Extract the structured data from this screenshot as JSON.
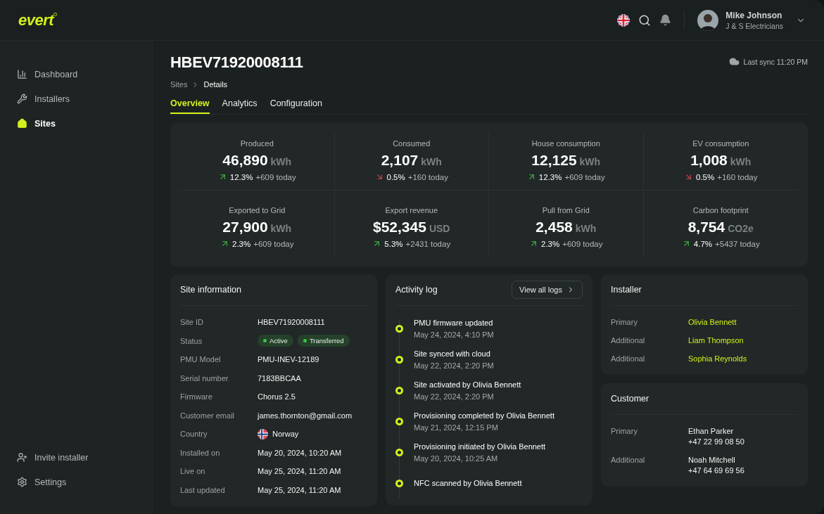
{
  "brand": {
    "logo": "evert"
  },
  "header": {
    "user": {
      "name": "Mike Johnson",
      "company": "J & S Electricians"
    }
  },
  "sidebar": {
    "items": [
      {
        "label": "Dashboard",
        "selected": false
      },
      {
        "label": "Installers",
        "selected": false
      },
      {
        "label": "Sites",
        "selected": true
      }
    ],
    "footer_items": [
      {
        "label": "Invite installer"
      },
      {
        "label": "Settings"
      }
    ]
  },
  "page": {
    "title": "HBEV71920008111",
    "last_sync": "Last sync 11:20 PM",
    "breadcrumb": [
      "Sites",
      "Details"
    ],
    "tabs": [
      {
        "label": "Overview",
        "selected": true
      },
      {
        "label": "Analytics",
        "selected": false
      },
      {
        "label": "Configuration",
        "selected": false
      }
    ]
  },
  "stats": [
    {
      "label": "Produced",
      "value": "46,890",
      "unit": "kWh",
      "kind": "up",
      "change": "12.3%",
      "today": "+609 today"
    },
    {
      "label": "Consumed",
      "value": "2,107",
      "unit": "kWh",
      "kind": "down",
      "change": "0.5%",
      "today": "+160 today"
    },
    {
      "label": "House consumption",
      "value": "12,125",
      "unit": "kWh",
      "kind": "up",
      "change": "12.3%",
      "today": "+609 today"
    },
    {
      "label": "EV consumption",
      "value": "1,008",
      "unit": "kWh",
      "kind": "down",
      "change": "0.5%",
      "today": "+160 today"
    },
    {
      "label": "Exported to Grid",
      "value": "27,900",
      "unit": "kWh",
      "kind": "up",
      "change": "2.3%",
      "today": "+609 today"
    },
    {
      "label": "Export revenue",
      "value": "$52,345",
      "unit": "USD",
      "kind": "up",
      "change": "5.3%",
      "today": "+2431 today"
    },
    {
      "label": "Pull from Grid",
      "value": "2,458",
      "unit": "kWh",
      "kind": "up",
      "change": "2.3%",
      "today": "+609 today"
    },
    {
      "label": "Carbon footprint",
      "value": "8,754",
      "unit": "CO2e",
      "kind": "up",
      "change": "4.7%",
      "today": "+5437 today"
    }
  ],
  "site_information": {
    "title": "Site information",
    "rows": [
      {
        "label": "Site ID",
        "kind": "text",
        "value": "HBEV71920008111"
      },
      {
        "label": "Status",
        "kind": "badges",
        "badges": [
          {
            "label": "Active",
            "color": "#3fbf4a"
          },
          {
            "label": "Transferred",
            "color": "#3fbf4a"
          }
        ]
      },
      {
        "label": "PMU Model",
        "kind": "text",
        "value": "PMU-INEV-12189"
      },
      {
        "label": "Serial number",
        "kind": "text",
        "value": "7183BBCAA"
      },
      {
        "label": "Firmware",
        "kind": "text",
        "value": "Chorus 2.5"
      },
      {
        "label": "Customer email",
        "kind": "text",
        "value": "james.thornton@gmail.com"
      },
      {
        "label": "Country",
        "kind": "country",
        "value": "Norway"
      },
      {
        "label": "Installed on",
        "kind": "text",
        "value": "May 20, 2024, 10:20 AM"
      },
      {
        "label": "Live on",
        "kind": "text",
        "value": "May 25, 2024, 11:20 AM"
      },
      {
        "label": "Last updated",
        "kind": "text",
        "value": "May 25, 2024, 11:20 AM"
      }
    ]
  },
  "activity_log": {
    "title": "Activity log",
    "button": "View all logs",
    "items": [
      {
        "event": "PMU firmware updated",
        "time": "May 24, 2024, 4:10 PM"
      },
      {
        "event": "Site synced with cloud",
        "time": "May 22, 2024, 2:20 PM"
      },
      {
        "event": "Site activated by Olivia Bennett",
        "time": "May 22, 2024, 2:20 PM"
      },
      {
        "event": "Provisioning completed by Olivia Bennett",
        "time": "May 21, 2024, 12:15 PM"
      },
      {
        "event": "Provisioning initiated by Olivia Bennett",
        "time": "May 20, 2024, 10:25 AM"
      },
      {
        "event": "NFC scanned by Olivia Bennett"
      }
    ]
  },
  "installer": {
    "title": "Installer",
    "rows": [
      {
        "role": "Primary",
        "name": "Olivia Bennett"
      },
      {
        "role": "Additional",
        "name": "Liam Thompson"
      },
      {
        "role": "Additional",
        "name": "Sophia Reynolds"
      }
    ]
  },
  "customer": {
    "title": "Customer",
    "rows": [
      {
        "role": "Primary",
        "name": "Ethan Parker",
        "phone": "+47 22 99 08 50"
      },
      {
        "role": "Additional",
        "name": "Noah Mitchell",
        "phone": "+47 64 69 69 56"
      }
    ]
  }
}
